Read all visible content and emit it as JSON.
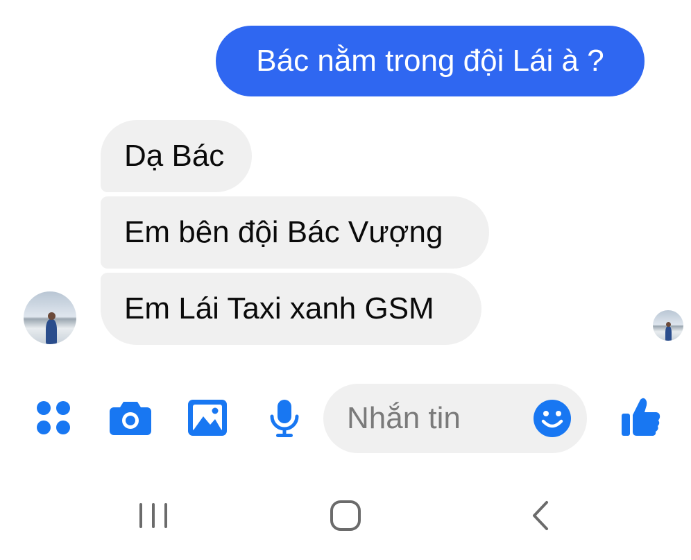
{
  "conversation": {
    "outgoing": [
      {
        "text": "Bác nằm trong đội Lái à ?"
      }
    ],
    "incoming": [
      {
        "text": "Dạ Bác"
      },
      {
        "text": "Em bên đội Bác Vượng"
      },
      {
        "text": "Em Lái Taxi xanh GSM"
      }
    ]
  },
  "composer": {
    "placeholder": "Nhắn tin",
    "icons": [
      "menu-grid-icon",
      "camera-icon",
      "gallery-icon",
      "microphone-icon",
      "emoji-icon",
      "thumbs-up-icon"
    ]
  },
  "navigation_bar": {
    "icons": [
      "recent-apps-icon",
      "home-icon",
      "back-icon"
    ]
  },
  "colors": {
    "accent": "#2f67f1",
    "icon_blue": "#1877f2",
    "incoming_bubble": "#f0f0f0",
    "nav_icon": "#6b6b6b"
  }
}
